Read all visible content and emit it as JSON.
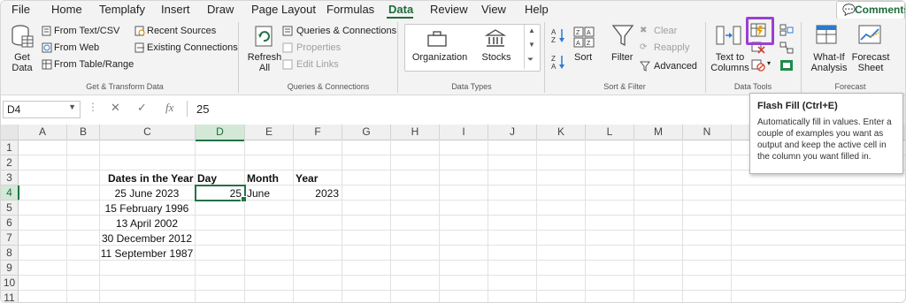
{
  "menu": {
    "tabs": [
      "File",
      "Home",
      "Templafy",
      "Insert",
      "Draw",
      "Page Layout",
      "Formulas",
      "Data",
      "Review",
      "View",
      "Help"
    ],
    "active_tab": "Data",
    "comments_label": "Comments"
  },
  "ribbon": {
    "get_transform": {
      "get_data": "Get Data",
      "from_text_csv": "From Text/CSV",
      "from_web": "From Web",
      "from_table_range": "From Table/Range",
      "recent_sources": "Recent Sources",
      "existing_connections": "Existing Connections",
      "group_label": "Get & Transform Data"
    },
    "queries": {
      "refresh_all": "Refresh All",
      "queries_connections": "Queries & Connections",
      "properties": "Properties",
      "edit_links": "Edit Links",
      "group_label": "Queries & Connections"
    },
    "data_types": {
      "organization": "Organization",
      "stocks": "Stocks",
      "group_label": "Data Types"
    },
    "sort_filter": {
      "sort": "Sort",
      "filter": "Filter",
      "clear": "Clear",
      "reapply": "Reapply",
      "advanced": "Advanced",
      "group_label": "Sort & Filter"
    },
    "data_tools": {
      "text_to_columns": "Text to Columns",
      "group_label": "Data Tools"
    },
    "forecast": {
      "what_if": "What-If Analysis",
      "forecast_sheet": "Forecast Sheet",
      "group_label": "Forecast"
    }
  },
  "formula_bar": {
    "name_box": "D4",
    "fx": "fx",
    "value": "25"
  },
  "columns": [
    "A",
    "B",
    "C",
    "D",
    "E",
    "F",
    "G",
    "H",
    "I",
    "J",
    "K",
    "L",
    "M",
    "N"
  ],
  "rows": [
    "1",
    "2",
    "3",
    "4",
    "5",
    "6",
    "7",
    "8",
    "9",
    "10",
    "11"
  ],
  "cells": {
    "c3": "Dates in the Year",
    "d3": "Day",
    "e3": "Month",
    "f3": "Year",
    "c4": "25 June 2023",
    "d4": "25",
    "e4": "June",
    "f4": "2023",
    "c5": "15 February 1996",
    "c6": "13 April 2002",
    "c7": "30 December 2012",
    "c8": "11 September 1987"
  },
  "tooltip": {
    "title": "Flash Fill (Ctrl+E)",
    "description": "Automatically fill in values. Enter a couple of examples you want as output and keep the active cell in the column you want filled in."
  },
  "colors": {
    "accent": "#217346",
    "highlight": "#9b3fd4"
  }
}
